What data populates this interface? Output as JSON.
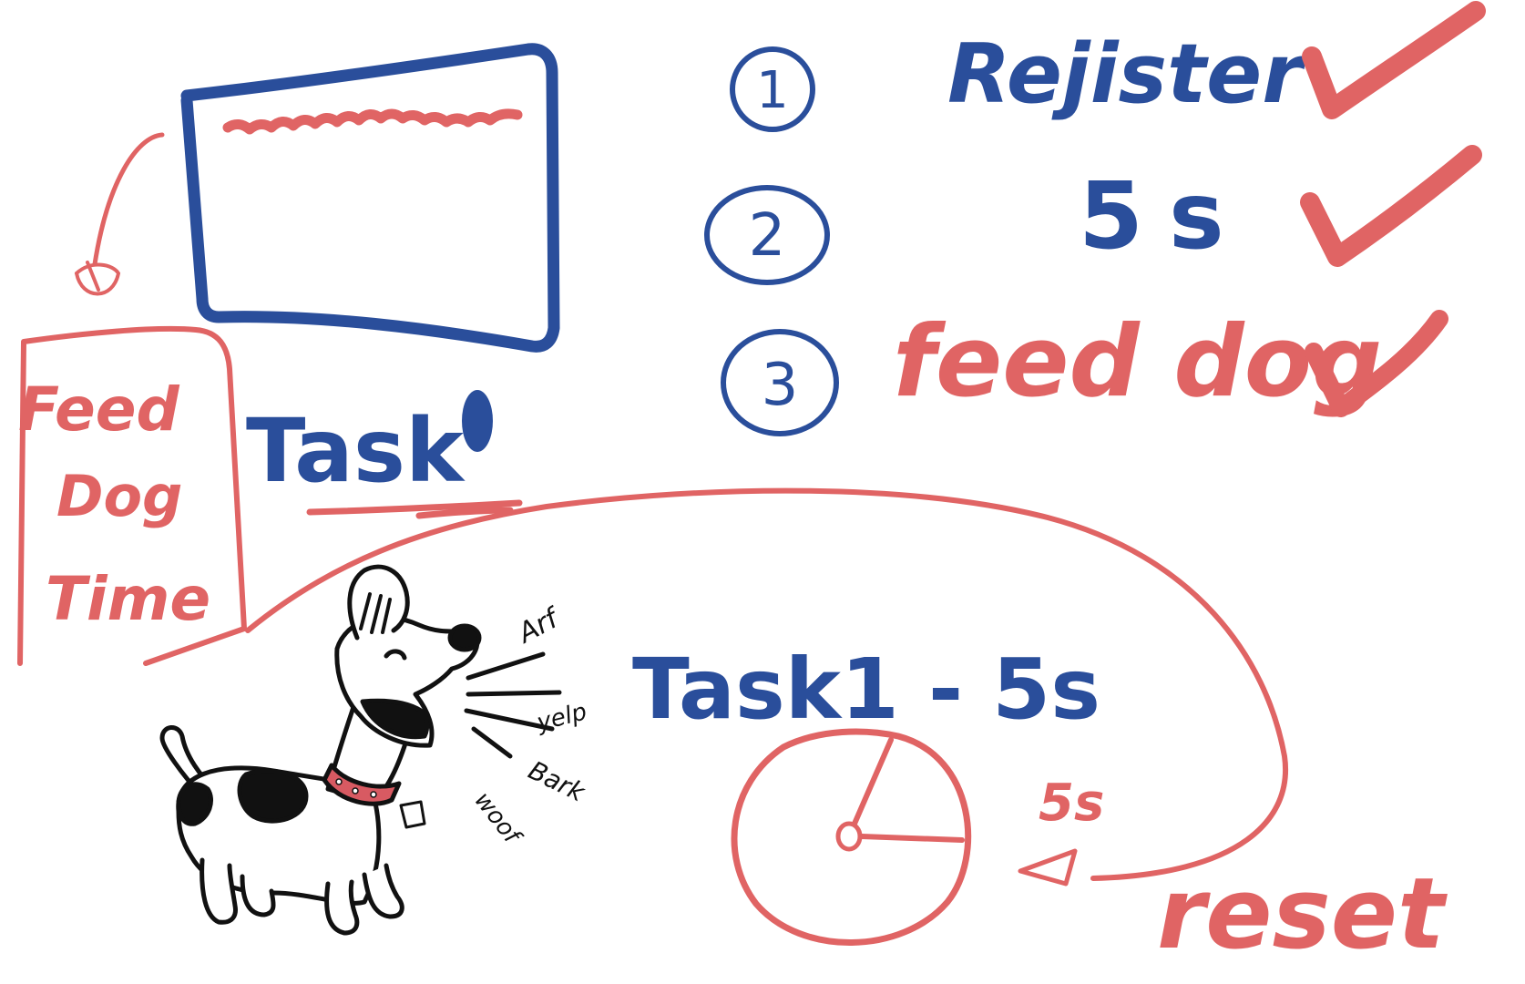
{
  "colors": {
    "blue": "#2a4e9b",
    "red": "#e06464",
    "ink": "#111111",
    "collar": "#d85a62"
  },
  "steps": [
    {
      "number": "1",
      "text": "Rejister"
    },
    {
      "number": "2",
      "text": "5s"
    },
    {
      "number": "3",
      "text": "feed dog"
    }
  ],
  "note_box": {
    "line1": "Feed",
    "line2": "Dog",
    "line3": "Time"
  },
  "task_label": "Task",
  "timer_label": "Task1 - 5s",
  "timer_interval": "5s",
  "reset_label": "reset",
  "dog_sounds": [
    "Arf",
    "yelp",
    "Bark",
    "woof"
  ],
  "icons": {
    "dog": "barking-dog-icon",
    "check": "checkmark-icon",
    "clock": "clock-icon"
  }
}
